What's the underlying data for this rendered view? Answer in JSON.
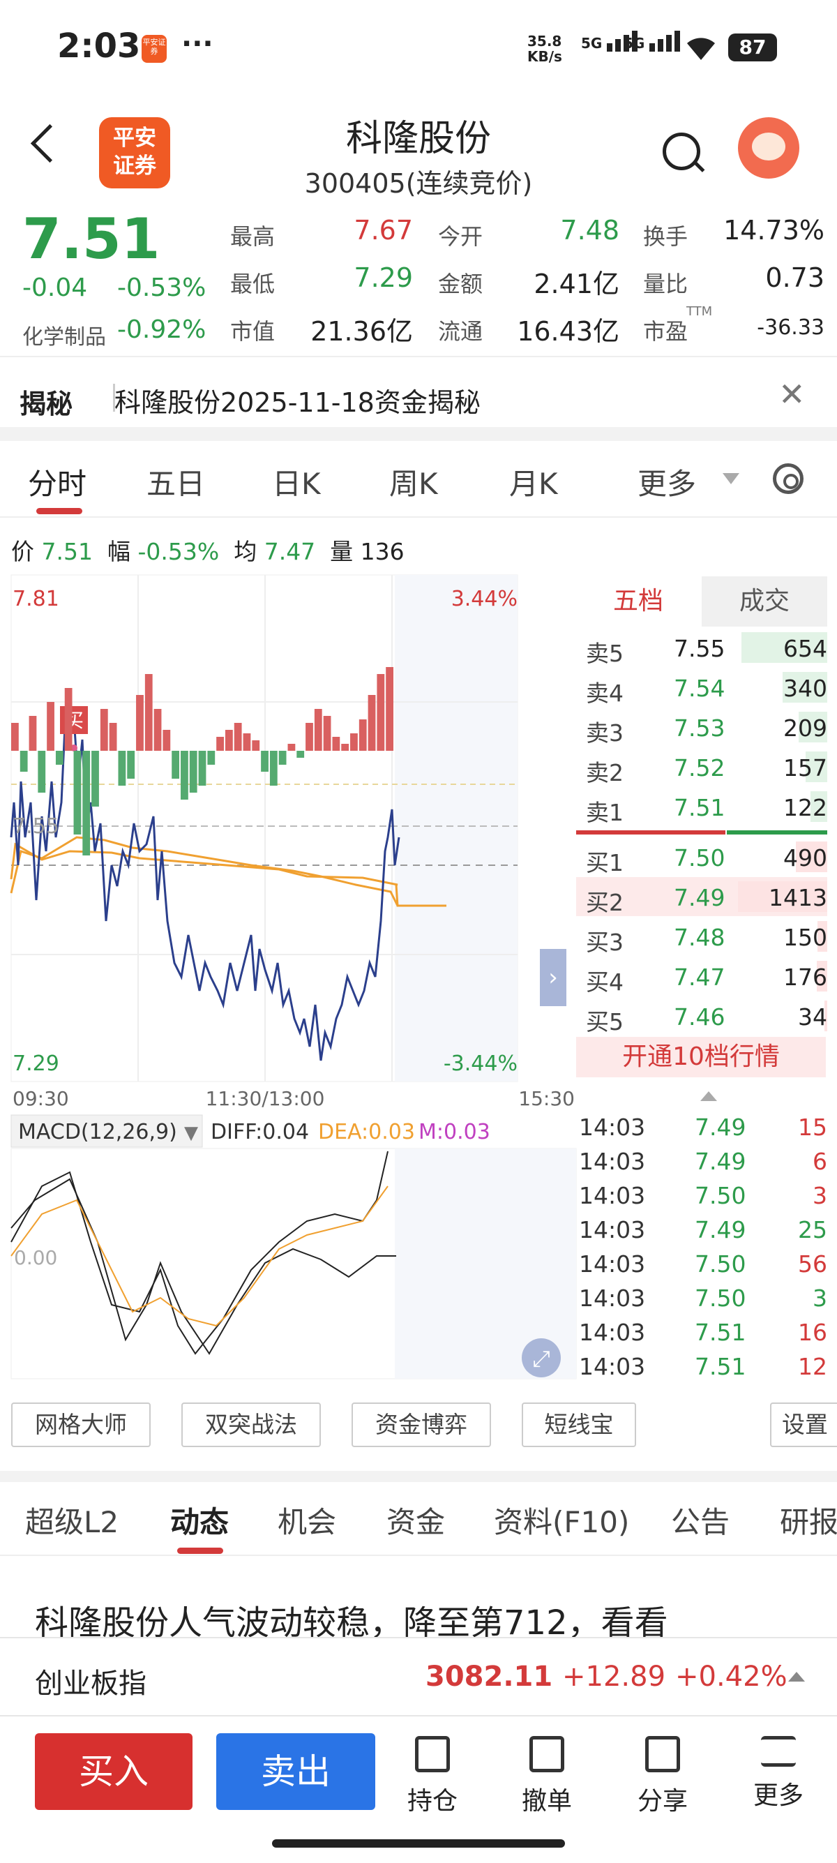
{
  "status_bar": {
    "time": "2:03",
    "app_badge": "平安证券",
    "more": "···",
    "net_speed_top": "35.8",
    "net_speed_unit": "KB/s",
    "signal1": "5G",
    "signal2": "5G",
    "battery": "87"
  },
  "header": {
    "logo_text_1": "平安",
    "logo_text_2": "证券",
    "title": "科隆股份",
    "subtitle": "300405(连续竞价)"
  },
  "quote": {
    "price": "7.51",
    "change": "-0.04",
    "change_pct": "-0.53%",
    "industry": "化学制品",
    "industry_pct": "-0.92%",
    "fields": [
      {
        "label": "最高",
        "value": "7.67",
        "color": "red"
      },
      {
        "label": "今开",
        "value": "7.48",
        "color": "green"
      },
      {
        "label": "换手",
        "value": "14.73%",
        "color": "black"
      },
      {
        "label": "最低",
        "value": "7.29",
        "color": "green"
      },
      {
        "label": "金额",
        "value": "2.41亿",
        "color": "black"
      },
      {
        "label": "量比",
        "value": "0.73",
        "color": "black"
      },
      {
        "label": "市值",
        "value": "21.36亿",
        "color": "black"
      },
      {
        "label": "流通",
        "value": "16.43亿",
        "color": "black"
      },
      {
        "label": "市盈",
        "value": "-36.33",
        "color": "black",
        "sup": "TTM"
      }
    ]
  },
  "banner": {
    "tag": "揭秘",
    "text": "科隆股份2025-11-18资金揭秘"
  },
  "kline_tabs": [
    "分时",
    "五日",
    "日K",
    "周K",
    "月K",
    "更多"
  ],
  "info_line": {
    "p_label": "价",
    "p_val": "7.51",
    "f_label": "幅",
    "f_val": "-0.53%",
    "a_label": "均",
    "a_val": "7.47",
    "v_label": "量",
    "v_val": "136"
  },
  "chart_data": {
    "type": "line",
    "y_max": "7.81",
    "y_min": "7.29",
    "pct_max": "3.44%",
    "pct_min": "-3.44%",
    "ref_label": "7.55",
    "x_labels": [
      "09:30",
      "11:30/13:00",
      "15:30"
    ],
    "buy_marker": "买",
    "macd": {
      "title": "MACD(12,26,9)",
      "diff": "DIFF:0.04",
      "dea": "DEA:0.03",
      "m": "M:0.03",
      "zero_label": "0.00"
    }
  },
  "order_book": {
    "tabs": [
      "五档",
      "成交"
    ],
    "asks": [
      {
        "k": "卖5",
        "p": "7.55",
        "v": "654",
        "r": 0.96
      },
      {
        "k": "卖4",
        "p": "7.54",
        "v": "340",
        "r": 0.5
      },
      {
        "k": "卖3",
        "p": "7.53",
        "v": "209",
        "r": 0.32
      },
      {
        "k": "卖2",
        "p": "7.52",
        "v": "157",
        "r": 0.24
      },
      {
        "k": "卖1",
        "p": "7.51",
        "v": "122",
        "r": 0.19
      }
    ],
    "bids": [
      {
        "k": "买1",
        "p": "7.50",
        "v": "490",
        "r": 0.35
      },
      {
        "k": "买2",
        "p": "7.49",
        "v": "1413",
        "r": 1.0
      },
      {
        "k": "买3",
        "p": "7.48",
        "v": "150",
        "r": 0.11
      },
      {
        "k": "买4",
        "p": "7.47",
        "v": "176",
        "r": 0.12
      },
      {
        "k": "买5",
        "p": "7.46",
        "v": "34",
        "r": 0.03
      }
    ],
    "upgrade": "开通10档行情"
  },
  "trades": [
    {
      "t": "14:03",
      "p": "7.49",
      "v": "15",
      "c": "red"
    },
    {
      "t": "14:03",
      "p": "7.49",
      "v": "6",
      "c": "red"
    },
    {
      "t": "14:03",
      "p": "7.50",
      "v": "3",
      "c": "red"
    },
    {
      "t": "14:03",
      "p": "7.49",
      "v": "25",
      "c": "green"
    },
    {
      "t": "14:03",
      "p": "7.50",
      "v": "56",
      "c": "red"
    },
    {
      "t": "14:03",
      "p": "7.50",
      "v": "3",
      "c": "green"
    },
    {
      "t": "14:03",
      "p": "7.51",
      "v": "16",
      "c": "red"
    },
    {
      "t": "14:03",
      "p": "7.51",
      "v": "12",
      "c": "red"
    }
  ],
  "tools": [
    "网格大师",
    "双突战法",
    "资金博弈",
    "短线宝",
    "设置"
  ],
  "section_tabs": [
    "超级L2",
    "动态",
    "机会",
    "资金",
    "资料(F10)",
    "公告",
    "研报"
  ],
  "news": "科隆股份人气波动较稳，降至第712，看看",
  "index": {
    "name": "创业板指",
    "value": "3082.11",
    "change": "+12.89",
    "pct": "+0.42%"
  },
  "bottom": {
    "buy": "买入",
    "sell": "卖出",
    "items": [
      "持仓",
      "撤单",
      "分享",
      "更多"
    ]
  }
}
